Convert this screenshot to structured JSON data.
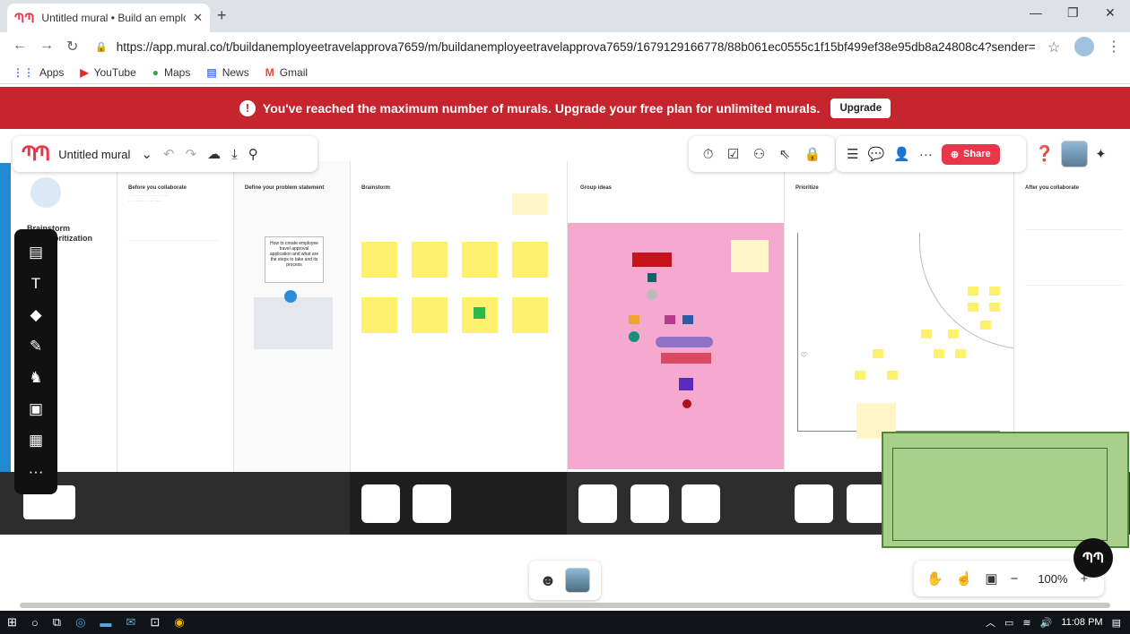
{
  "browser": {
    "tab_title": "Untitled mural • Build an employ",
    "tab_close": "✕",
    "new_tab": "+",
    "url": "https://app.mural.co/t/buildanemployeetravelapprova7659/m/buildanemployeetravelapprova7659/1679129166778/88b061ec0555c1f15bf499ef38e95db8a24808c4?sender=ucfe...",
    "bookmarks": [
      {
        "label": "Apps",
        "icon": "apps-grid-icon"
      },
      {
        "label": "YouTube",
        "icon": "youtube-icon"
      },
      {
        "label": "Maps",
        "icon": "maps-icon"
      },
      {
        "label": "News",
        "icon": "news-icon"
      },
      {
        "label": "Gmail",
        "icon": "gmail-icon"
      }
    ]
  },
  "banner": {
    "message": "You've reached the maximum number of murals. Upgrade your free plan for unlimited murals.",
    "button": "Upgrade",
    "color": "#c4252e"
  },
  "toolbar": {
    "mural_name": "Untitled mural",
    "share_label": "Share",
    "accent": "#e8374a"
  },
  "canvas": {
    "panels": [
      {
        "title": "Brainstorm\nand prioritization"
      },
      {
        "title": "Before you collaborate"
      },
      {
        "title": "Define your problem statement"
      },
      {
        "title": "Brainstorm"
      },
      {
        "title": "Group ideas"
      },
      {
        "title": "Prioritize"
      },
      {
        "title": "After you collaborate"
      }
    ],
    "problem_card": "How to create employee travel approval application and what are the steps to take and its process",
    "brainstorm_color": "#fdf16d",
    "group_bg": "#f6a9cf"
  },
  "zoom": {
    "level": "100%",
    "minus": "−",
    "plus": "+"
  },
  "taskbar": {
    "time": "11:08 PM"
  }
}
